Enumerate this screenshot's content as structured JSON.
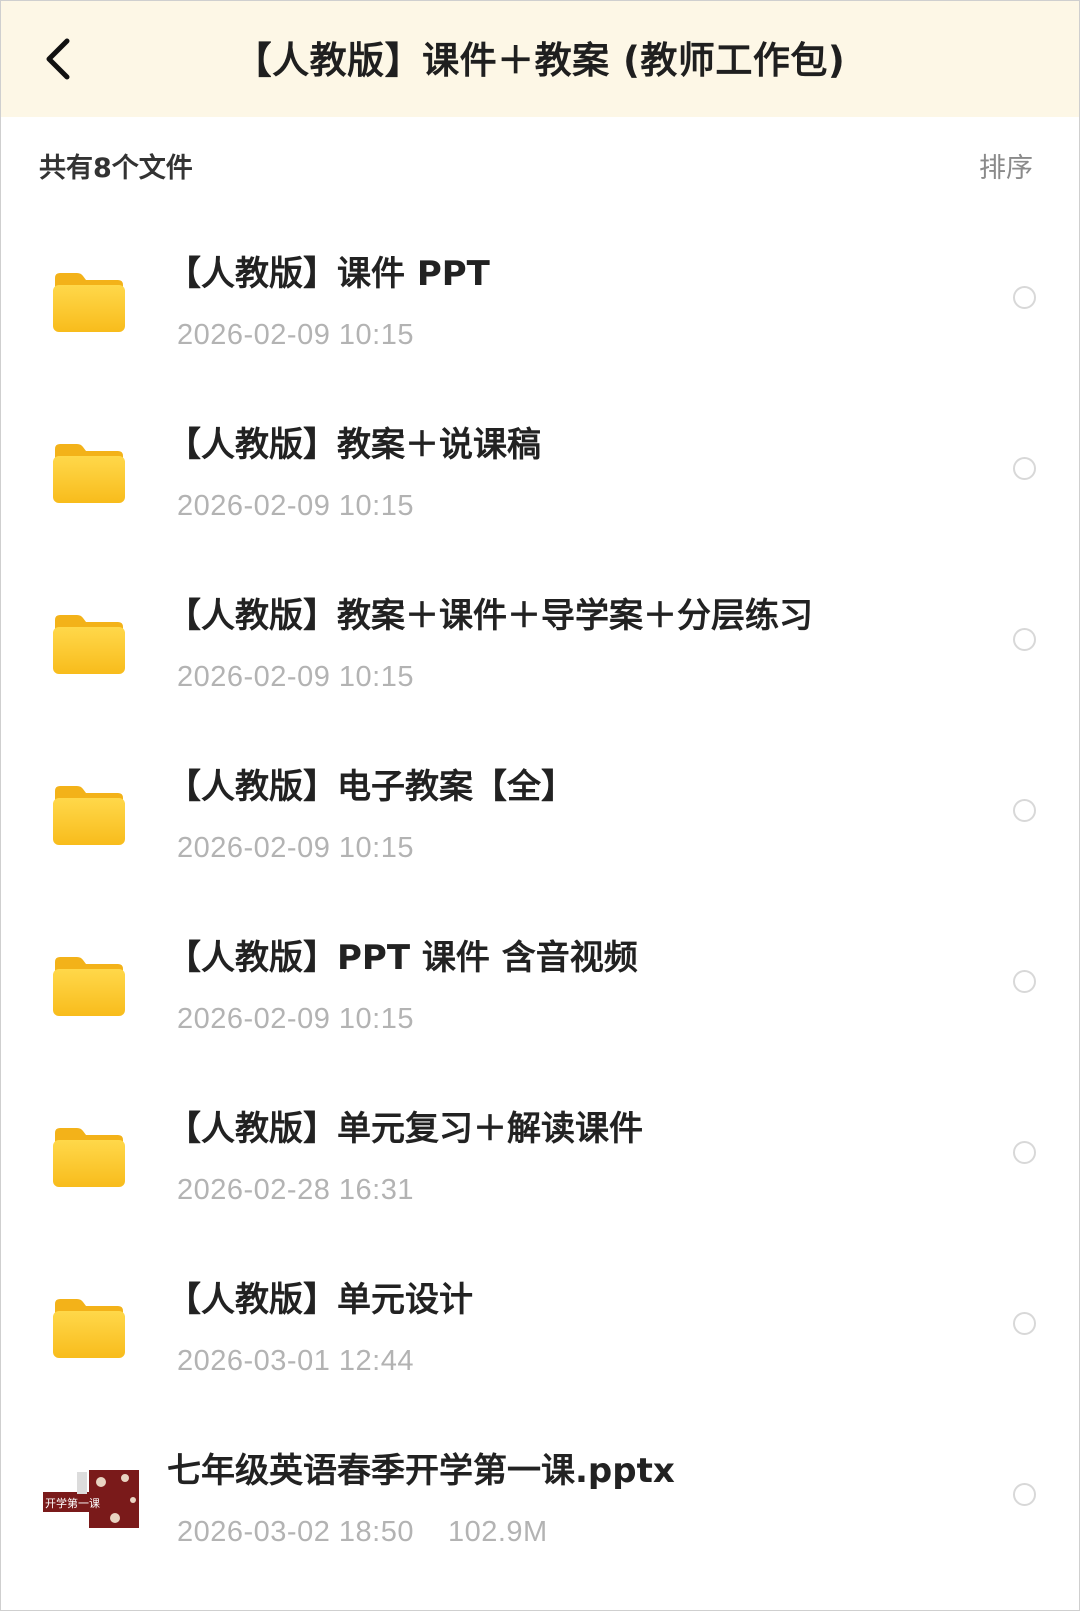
{
  "header": {
    "title": "【人教版】课件＋教案 (教师工作包)",
    "back_icon": "chevron-left-icon"
  },
  "toolbar": {
    "summary": "共有8个文件",
    "sort_label": "排序"
  },
  "colors": {
    "header_bg": "#fdf7e6",
    "folder_yellow": "#fbc52a",
    "timestamp_gray": "#b3b3b3"
  },
  "files": [
    {
      "name": "【人教版】课件 PPT",
      "date": "2026-02-09 10:15",
      "type": "folder"
    },
    {
      "name": "【人教版】教案＋说课稿",
      "date": "2026-02-09 10:15",
      "type": "folder"
    },
    {
      "name": "【人教版】教案＋课件＋导学案＋分层练习",
      "date": "2026-02-09 10:15",
      "type": "folder"
    },
    {
      "name": "【人教版】电子教案【全】",
      "date": "2026-02-09 10:15",
      "type": "folder"
    },
    {
      "name": "【人教版】PPT 课件 含音视频",
      "date": "2026-02-09 10:15",
      "type": "folder"
    },
    {
      "name": "【人教版】单元复习＋解读课件",
      "date": "2026-02-28 16:31",
      "type": "folder"
    },
    {
      "name": "【人教版】单元设计",
      "date": "2026-03-01 12:44",
      "type": "folder"
    },
    {
      "name": "七年级英语春季开学第一课.pptx",
      "date": "2026-03-02 18:50",
      "size": "102.9M",
      "type": "pptx",
      "thumb_text": "开学第一课"
    }
  ]
}
